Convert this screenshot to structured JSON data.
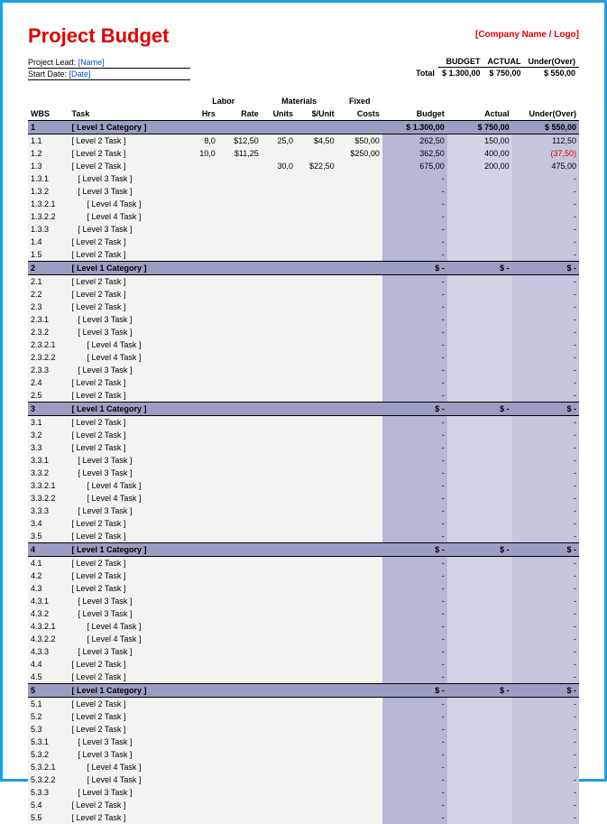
{
  "title": "Project Budget",
  "company": "[Company Name / Logo]",
  "meta": {
    "lead_lbl": "Project Lead:",
    "lead_val": "[Name]",
    "date_lbl": "Start Date:",
    "date_val": "[Date]"
  },
  "totals": {
    "head_budget": "BUDGET",
    "head_actual": "ACTUAL",
    "head_uo": "Under(Over)",
    "row_lbl": "Total",
    "budget": "$    1.300,00",
    "actual": "$       750,00",
    "uo": "$       550,00"
  },
  "headers": {
    "grp_labor": "Labor",
    "grp_materials": "Materials",
    "grp_fixed": "Fixed",
    "wbs": "WBS",
    "task": "Task",
    "hrs": "Hrs",
    "rate": "Rate",
    "units": "Units",
    "unitp": "$/Unit",
    "fixed": "Costs",
    "budget": "Budget",
    "actual": "Actual",
    "uo": "Under(Over)"
  },
  "rows": [
    {
      "t": "cat",
      "wbs": "1",
      "task": "[ Level 1 Category ]",
      "b": "$    1.300,00",
      "a": "$       750,00",
      "u": "$       550,00"
    },
    {
      "t": "r",
      "lvl": 1,
      "wbs": "1.1",
      "task": "[ Level 2 Task ]",
      "hrs": "8,0",
      "rate": "$12,50",
      "units": "25,0",
      "unitp": "$4,50",
      "fixed": "$50,00",
      "b": "262,50",
      "a": "150,00",
      "u": "112,50"
    },
    {
      "t": "r",
      "lvl": 1,
      "wbs": "1.2",
      "task": "[ Level 2 Task ]",
      "hrs": "10,0",
      "rate": "$11,25",
      "units": "",
      "unitp": "",
      "fixed": "$250,00",
      "b": "362,50",
      "a": "400,00",
      "u": "(37,50)",
      "neg": true
    },
    {
      "t": "r",
      "lvl": 1,
      "wbs": "1.3",
      "task": "[ Level 2 Task ]",
      "hrs": "",
      "rate": "",
      "units": "30,0",
      "unitp": "$22,50",
      "fixed": "",
      "b": "675,00",
      "a": "200,00",
      "u": "475,00"
    },
    {
      "t": "r",
      "lvl": 2,
      "wbs": "1.3.1",
      "task": "[ Level 3 Task ]",
      "b": "-",
      "a": "",
      "u": "-"
    },
    {
      "t": "r",
      "lvl": 2,
      "wbs": "1.3.2",
      "task": "[ Level 3 Task ]",
      "b": "-",
      "a": "",
      "u": "-"
    },
    {
      "t": "r",
      "lvl": 3,
      "wbs": "1.3.2.1",
      "task": "[ Level 4 Task ]",
      "b": "-",
      "a": "",
      "u": "-"
    },
    {
      "t": "r",
      "lvl": 3,
      "wbs": "1.3.2.2",
      "task": "[ Level 4 Task ]",
      "b": "-",
      "a": "",
      "u": "-"
    },
    {
      "t": "r",
      "lvl": 2,
      "wbs": "1.3.3",
      "task": "[ Level 3 Task ]",
      "b": "-",
      "a": "",
      "u": "-"
    },
    {
      "t": "r",
      "lvl": 1,
      "wbs": "1.4",
      "task": "[ Level 2 Task ]",
      "b": "-",
      "a": "",
      "u": "-"
    },
    {
      "t": "r",
      "lvl": 1,
      "wbs": "1.5",
      "task": "[ Level 2 Task ]",
      "b": "-",
      "a": "",
      "u": "-"
    },
    {
      "t": "cat",
      "wbs": "2",
      "task": "[ Level 1 Category ]",
      "b": "$                -",
      "a": "$               -",
      "u": "$                -"
    },
    {
      "t": "r",
      "lvl": 1,
      "wbs": "2.1",
      "task": "[ Level 2 Task ]",
      "b": "-",
      "a": "",
      "u": "-"
    },
    {
      "t": "r",
      "lvl": 1,
      "wbs": "2.2",
      "task": "[ Level 2 Task ]",
      "b": "-",
      "a": "",
      "u": "-"
    },
    {
      "t": "r",
      "lvl": 1,
      "wbs": "2.3",
      "task": "[ Level 2 Task ]",
      "b": "-",
      "a": "",
      "u": "-"
    },
    {
      "t": "r",
      "lvl": 2,
      "wbs": "2.3.1",
      "task": "[ Level 3 Task ]",
      "b": "-",
      "a": "",
      "u": "-"
    },
    {
      "t": "r",
      "lvl": 2,
      "wbs": "2.3.2",
      "task": "[ Level 3 Task ]",
      "b": "-",
      "a": "",
      "u": "-"
    },
    {
      "t": "r",
      "lvl": 3,
      "wbs": "2.3.2.1",
      "task": "[ Level 4 Task ]",
      "b": "-",
      "a": "",
      "u": "-"
    },
    {
      "t": "r",
      "lvl": 3,
      "wbs": "2.3.2.2",
      "task": "[ Level 4 Task ]",
      "b": "-",
      "a": "",
      "u": "-"
    },
    {
      "t": "r",
      "lvl": 2,
      "wbs": "2.3.3",
      "task": "[ Level 3 Task ]",
      "b": "-",
      "a": "",
      "u": "-"
    },
    {
      "t": "r",
      "lvl": 1,
      "wbs": "2.4",
      "task": "[ Level 2 Task ]",
      "b": "-",
      "a": "",
      "u": "-"
    },
    {
      "t": "r",
      "lvl": 1,
      "wbs": "2.5",
      "task": "[ Level 2 Task ]",
      "b": "-",
      "a": "",
      "u": "-"
    },
    {
      "t": "cat",
      "wbs": "3",
      "task": "[ Level 1 Category ]",
      "b": "$                -",
      "a": "$               -",
      "u": "$                -"
    },
    {
      "t": "r",
      "lvl": 1,
      "wbs": "3.1",
      "task": "[ Level 2 Task ]",
      "b": "-",
      "a": "",
      "u": "-"
    },
    {
      "t": "r",
      "lvl": 1,
      "wbs": "3.2",
      "task": "[ Level 2 Task ]",
      "b": "-",
      "a": "",
      "u": "-"
    },
    {
      "t": "r",
      "lvl": 1,
      "wbs": "3.3",
      "task": "[ Level 2 Task ]",
      "b": "-",
      "a": "",
      "u": "-"
    },
    {
      "t": "r",
      "lvl": 2,
      "wbs": "3.3.1",
      "task": "[ Level 3 Task ]",
      "b": "-",
      "a": "",
      "u": "-"
    },
    {
      "t": "r",
      "lvl": 2,
      "wbs": "3.3.2",
      "task": "[ Level 3 Task ]",
      "b": "-",
      "a": "",
      "u": "-"
    },
    {
      "t": "r",
      "lvl": 3,
      "wbs": "3.3.2.1",
      "task": "[ Level 4 Task ]",
      "b": "-",
      "a": "",
      "u": "-"
    },
    {
      "t": "r",
      "lvl": 3,
      "wbs": "3.3.2.2",
      "task": "[ Level 4 Task ]",
      "b": "-",
      "a": "",
      "u": "-"
    },
    {
      "t": "r",
      "lvl": 2,
      "wbs": "3.3.3",
      "task": "[ Level 3 Task ]",
      "b": "-",
      "a": "",
      "u": "-"
    },
    {
      "t": "r",
      "lvl": 1,
      "wbs": "3.4",
      "task": "[ Level 2 Task ]",
      "b": "-",
      "a": "",
      "u": "-"
    },
    {
      "t": "r",
      "lvl": 1,
      "wbs": "3.5",
      "task": "[ Level 2 Task ]",
      "b": "-",
      "a": "",
      "u": "-"
    },
    {
      "t": "cat",
      "wbs": "4",
      "task": "[ Level 1 Category ]",
      "b": "$                -",
      "a": "$               -",
      "u": "$                -"
    },
    {
      "t": "r",
      "lvl": 1,
      "wbs": "4.1",
      "task": "[ Level 2 Task ]",
      "b": "-",
      "a": "",
      "u": "-"
    },
    {
      "t": "r",
      "lvl": 1,
      "wbs": "4.2",
      "task": "[ Level 2 Task ]",
      "b": "-",
      "a": "",
      "u": "-"
    },
    {
      "t": "r",
      "lvl": 1,
      "wbs": "4.3",
      "task": "[ Level 2 Task ]",
      "b": "-",
      "a": "",
      "u": "-"
    },
    {
      "t": "r",
      "lvl": 2,
      "wbs": "4.3.1",
      "task": "[ Level 3 Task ]",
      "b": "-",
      "a": "",
      "u": "-"
    },
    {
      "t": "r",
      "lvl": 2,
      "wbs": "4.3.2",
      "task": "[ Level 3 Task ]",
      "b": "-",
      "a": "",
      "u": "-"
    },
    {
      "t": "r",
      "lvl": 3,
      "wbs": "4.3.2.1",
      "task": "[ Level 4 Task ]",
      "b": "-",
      "a": "",
      "u": "-"
    },
    {
      "t": "r",
      "lvl": 3,
      "wbs": "4.3.2.2",
      "task": "[ Level 4 Task ]",
      "b": "-",
      "a": "",
      "u": "-"
    },
    {
      "t": "r",
      "lvl": 2,
      "wbs": "4.3.3",
      "task": "[ Level 3 Task ]",
      "b": "-",
      "a": "",
      "u": "-"
    },
    {
      "t": "r",
      "lvl": 1,
      "wbs": "4.4",
      "task": "[ Level 2 Task ]",
      "b": "-",
      "a": "",
      "u": "-"
    },
    {
      "t": "r",
      "lvl": 1,
      "wbs": "4.5",
      "task": "[ Level 2 Task ]",
      "b": "-",
      "a": "",
      "u": "-"
    },
    {
      "t": "cat",
      "wbs": "5",
      "task": "[ Level 1 Category ]",
      "b": "$                -",
      "a": "$               -",
      "u": "$                -"
    },
    {
      "t": "r",
      "lvl": 1,
      "wbs": "5.1",
      "task": "[ Level 2 Task ]",
      "b": "-",
      "a": "",
      "u": "-"
    },
    {
      "t": "r",
      "lvl": 1,
      "wbs": "5.2",
      "task": "[ Level 2 Task ]",
      "b": "-",
      "a": "",
      "u": "-"
    },
    {
      "t": "r",
      "lvl": 1,
      "wbs": "5.3",
      "task": "[ Level 2 Task ]",
      "b": "-",
      "a": "",
      "u": "-"
    },
    {
      "t": "r",
      "lvl": 2,
      "wbs": "5.3.1",
      "task": "[ Level 3 Task ]",
      "b": "-",
      "a": "",
      "u": "-"
    },
    {
      "t": "r",
      "lvl": 2,
      "wbs": "5.3.2",
      "task": "[ Level 3 Task ]",
      "b": "-",
      "a": "",
      "u": "-"
    },
    {
      "t": "r",
      "lvl": 3,
      "wbs": "5.3.2.1",
      "task": "[ Level 4 Task ]",
      "b": "-",
      "a": "",
      "u": "-"
    },
    {
      "t": "r",
      "lvl": 3,
      "wbs": "5.3.2.2",
      "task": "[ Level 4 Task ]",
      "b": "-",
      "a": "",
      "u": "-"
    },
    {
      "t": "r",
      "lvl": 2,
      "wbs": "5.3.3",
      "task": "[ Level 3 Task ]",
      "b": "-",
      "a": "",
      "u": "-"
    },
    {
      "t": "r",
      "lvl": 1,
      "wbs": "5.4",
      "task": "[ Level 2 Task ]",
      "b": "-",
      "a": "",
      "u": "-"
    },
    {
      "t": "r",
      "lvl": 1,
      "wbs": "5.5",
      "task": "[ Level 2 Task ]",
      "b": "-",
      "a": "",
      "u": "-"
    }
  ]
}
